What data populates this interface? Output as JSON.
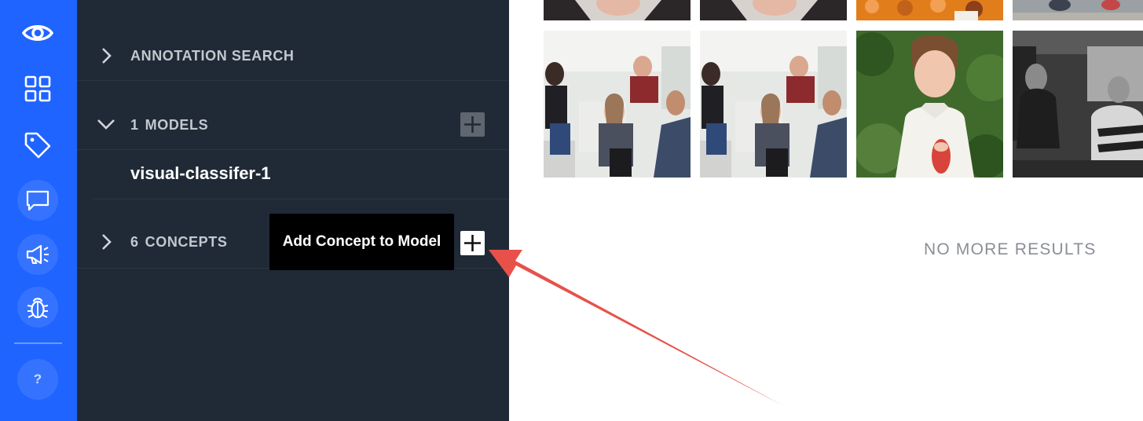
{
  "sidebar": {
    "icons": [
      "eye-icon",
      "grid-icon",
      "tag-icon",
      "chat-icon",
      "megaphone-icon",
      "bug-icon",
      "help-icon"
    ],
    "help_label": "?"
  },
  "panel": {
    "annotation_search": {
      "label": "ANNOTATION SEARCH"
    },
    "models": {
      "count": "1",
      "label": "MODELS",
      "items": [
        "visual-classifer-1"
      ]
    },
    "concepts": {
      "count": "6",
      "label": "CONCEPTS"
    },
    "tooltip": "Add Concept to Model"
  },
  "results": {
    "no_more_label": "NO MORE RESULTS"
  },
  "colors": {
    "rail": "#1f64ff",
    "panel": "#202a37",
    "arrow": "#e8514a"
  }
}
